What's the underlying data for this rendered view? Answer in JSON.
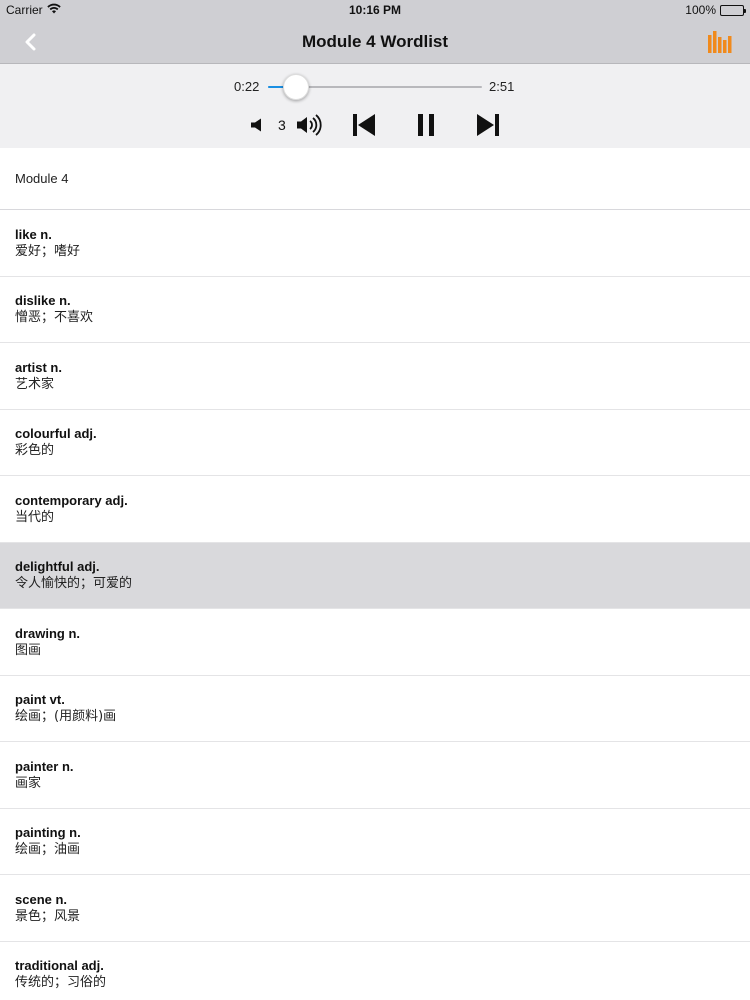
{
  "status_bar": {
    "carrier": "Carrier",
    "time": "10:16 PM",
    "battery": "100%"
  },
  "nav": {
    "title": "Module 4 Wordlist",
    "back_icon": "chevron-left-icon",
    "playlist_icon": "bars-icon",
    "accent_color": "#f08a1c"
  },
  "player": {
    "elapsed": "0:22",
    "total": "2:51",
    "progress": 0.1287,
    "volume_level": "3",
    "progress_color": "#1a8fe3"
  },
  "list": {
    "section_title": "Module 4",
    "selected_index": 5,
    "items": [
      {
        "word": "like n.",
        "meaning": "爱好；嗜好"
      },
      {
        "word": "dislike n.",
        "meaning": "憎恶；不喜欢"
      },
      {
        "word": "artist n.",
        "meaning": "艺术家"
      },
      {
        "word": "colourful adj.",
        "meaning": "彩色的"
      },
      {
        "word": "contemporary adj.",
        "meaning": "当代的"
      },
      {
        "word": "delightful adj.",
        "meaning": "令人愉快的；可爱的"
      },
      {
        "word": "drawing n.",
        "meaning": "图画"
      },
      {
        "word": "paint vt.",
        "meaning": "绘画；(用颜料)画"
      },
      {
        "word": "painter n.",
        "meaning": "画家"
      },
      {
        "word": "painting n.",
        "meaning": "绘画；油画"
      },
      {
        "word": "scene n.",
        "meaning": "景色；风景"
      },
      {
        "word": "traditional adj.",
        "meaning": "传统的；习俗的"
      }
    ]
  }
}
